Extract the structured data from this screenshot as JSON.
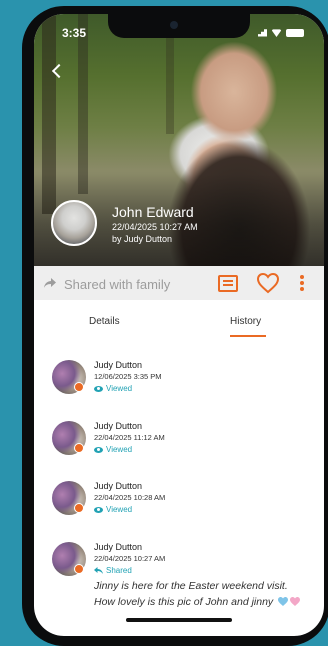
{
  "status_bar": {
    "time": "3:35"
  },
  "header": {
    "owner_name": "John Edward",
    "date": "22/04/2025 10:27 AM",
    "uploaded_by": "by Judy  Dutton"
  },
  "action_bar": {
    "share_label": "Shared with family",
    "accent_color": "#ea6a24"
  },
  "tabs": [
    {
      "label": "Details",
      "active": false
    },
    {
      "label": "History",
      "active": true
    }
  ],
  "history": [
    {
      "name": "Judy  Dutton",
      "time": "12/06/2025 3:35 PM",
      "action": "Viewed",
      "icon": "eye-icon",
      "comment": ""
    },
    {
      "name": "Judy  Dutton",
      "time": "22/04/2025 11:12 AM",
      "action": "Viewed",
      "icon": "eye-icon",
      "comment": ""
    },
    {
      "name": "Judy  Dutton",
      "time": "22/04/2025 10:28 AM",
      "action": "Viewed",
      "icon": "eye-icon",
      "comment": ""
    },
    {
      "name": "Judy  Dutton",
      "time": "22/04/2025 10:27 AM",
      "action": "Shared",
      "icon": "reply-icon",
      "comment": "Jinny is here for the Easter weekend visit. How lovely is this pic of John and jinny"
    }
  ]
}
